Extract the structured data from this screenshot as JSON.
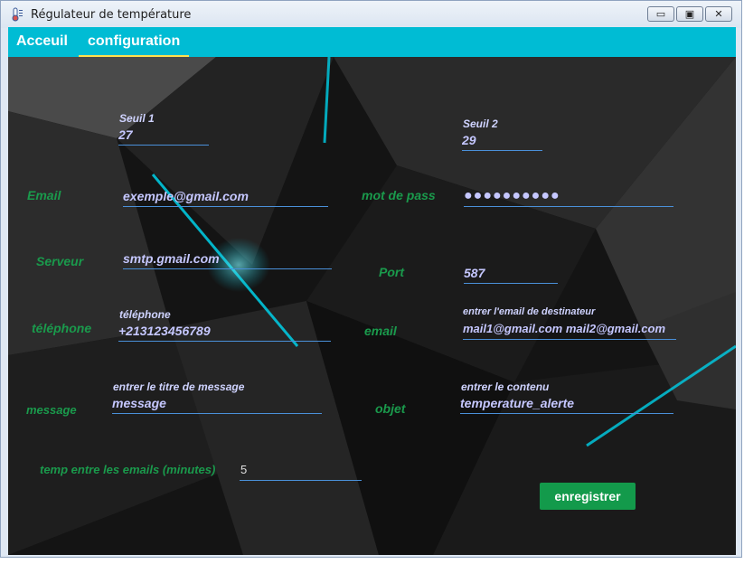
{
  "window": {
    "title": "Régulateur de température"
  },
  "tabs": [
    {
      "label": "Acceuil"
    },
    {
      "label": "configuration"
    }
  ],
  "form": {
    "seuil1": {
      "hint": "Seuil 1",
      "value": "27"
    },
    "seuil2": {
      "hint": "Seuil 2",
      "value": "29"
    },
    "email": {
      "label": "Email",
      "value": "exemple@gmail.com"
    },
    "password": {
      "label": "mot de pass",
      "value": "●●●●●●●●●●"
    },
    "serveur": {
      "label": "Serveur",
      "value": "smtp.gmail.com"
    },
    "port": {
      "label": "Port",
      "value": "587"
    },
    "telephone": {
      "label": "téléphone",
      "hint": "téléphone",
      "value": "+213123456789"
    },
    "dest_email": {
      "label": "email",
      "hint": "entrer l'email de destinateur",
      "value": "mail1@gmail.com mail2@gmail.com"
    },
    "message": {
      "label": "message",
      "hint": "entrer le titre de message",
      "value": "message"
    },
    "objet": {
      "label": "objet",
      "hint": "entrer le contenu",
      "value": "temperature_alerte"
    },
    "interval": {
      "label": "temp entre les emails (minutes)",
      "value": "5"
    },
    "save_label": "enregistrer"
  },
  "colors": {
    "accent": "#00bcd4",
    "label_green": "#1a9a4c",
    "button_green": "#139a4b",
    "underline": "#4a90d9",
    "tab_underline": "#ffe14d"
  }
}
